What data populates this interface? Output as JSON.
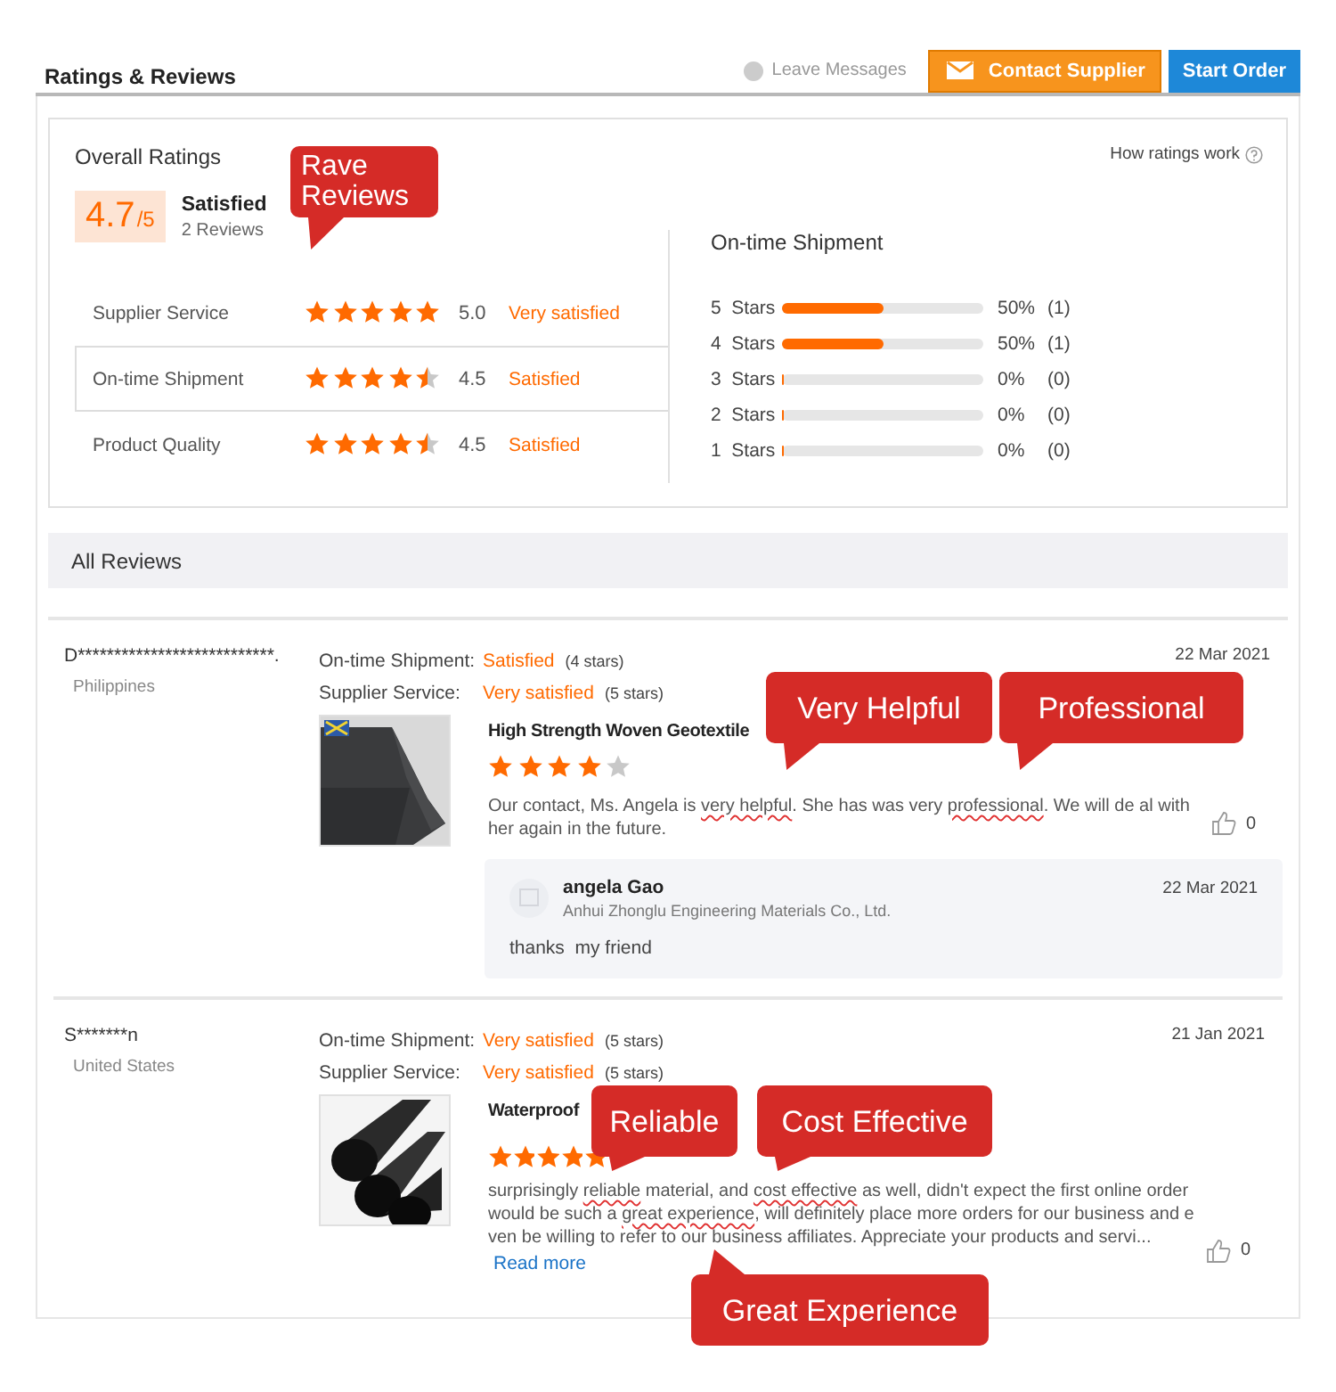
{
  "header": {
    "title": "Ratings & Reviews",
    "leave_messages": "Leave Messages",
    "buttons": [
      {
        "label": "Contact Supplier",
        "kind": "contact"
      },
      {
        "label": "Start Order",
        "kind": "order"
      }
    ]
  },
  "overall": {
    "heading": "Overall Ratings",
    "score": "4.7",
    "out_of": "/5",
    "verdict": "Satisfied",
    "count": "2 Reviews",
    "help_link": "How ratings work",
    "categories": [
      {
        "name": "Supplier Service",
        "stars": 5,
        "score": "5.0",
        "verdict": "Very satisfied",
        "selected": false
      },
      {
        "name": "On-time Shipment",
        "stars": 4.5,
        "score": "4.5",
        "verdict": "Satisfied",
        "selected": true
      },
      {
        "name": "Product Quality",
        "stars": 4.5,
        "score": "4.5",
        "verdict": "Satisfied",
        "selected": false
      }
    ]
  },
  "distribution": {
    "title": "On-time Shipment",
    "rows": [
      {
        "label": "5  Stars",
        "level": 0.5,
        "percent": "50%",
        "count": "(1)"
      },
      {
        "label": "4  Stars",
        "level": 0.5,
        "percent": "50%",
        "count": "(1)"
      },
      {
        "label": "3  Stars",
        "level": 0,
        "percent": "0%",
        "count": "(0)"
      },
      {
        "label": "2  Stars",
        "level": 0,
        "percent": "0%",
        "count": "(0)"
      },
      {
        "label": "1  Stars",
        "level": 0,
        "percent": "0%",
        "count": "(0)"
      }
    ]
  },
  "all_reviews": {
    "title": "All Reviews"
  },
  "reviews": [
    {
      "name": "D***************************.",
      "country": "Philippines",
      "date": "22 Mar 2021",
      "ratings": [
        {
          "label": "On-time Shipment:",
          "verdict": "Satisfied",
          "count": "(4 stars)"
        },
        {
          "label": "Supplier Service:",
          "verdict": "Very satisfied",
          "count": "(5 stars)"
        }
      ],
      "image": {
        "kind": "picture"
      },
      "product": "High Strength Woven Geotextile",
      "stars": 4,
      "text": [
        {
          "text": "Our contact, Ms. Angela is ",
          "highlight": false
        },
        {
          "text": "very helpful",
          "highlight": true
        },
        {
          "text": ". She has was very ",
          "highlight": false
        },
        {
          "text": "professional",
          "highlight": true
        },
        {
          "text": ". We will de al with her again in the future.",
          "highlight": false
        }
      ],
      "likes": "0",
      "reply": {
        "name": "angela Gao",
        "company": "Anhui Zhonglu Engineering Materials Co., Ltd.",
        "date": "22 Mar 2021",
        "text": "thanks  my friend"
      }
    },
    {
      "name": "S*******n",
      "country": "United States",
      "date": "21 Jan 2021",
      "ratings": [
        {
          "label": "On-time Shipment:",
          "verdict": "Very satisfied",
          "count": "(5 stars)"
        },
        {
          "label": "Supplier Service:",
          "verdict": "Very satisfied",
          "count": "(5 stars)"
        }
      ],
      "image": {
        "kind": "picture"
      },
      "product": "Waterproof",
      "stars": 5,
      "text": [
        {
          "text": "surprisingly ",
          "highlight": false
        },
        {
          "text": "reliable",
          "highlight": true
        },
        {
          "text": " material, and ",
          "highlight": false
        },
        {
          "text": "cost effective",
          "highlight": true
        },
        {
          "text": " as well, didn't expect the first online order would be such a ",
          "highlight": false
        },
        {
          "text": "great experience",
          "highlight": true
        },
        {
          "text": ", will definitely place more orders for our business  and even be willing to refer to our business affiliates. Appreciate your products and servi...",
          "highlight": false
        }
      ],
      "read_more": "Read more",
      "likes": "0"
    }
  ],
  "callouts": [
    {
      "text": "Rave Reviews"
    },
    {
      "text": "Very Helpful"
    },
    {
      "text": "Professional"
    },
    {
      "text": "Reliable"
    },
    {
      "text": "Cost Effective"
    },
    {
      "text": "Great Experience"
    }
  ]
}
